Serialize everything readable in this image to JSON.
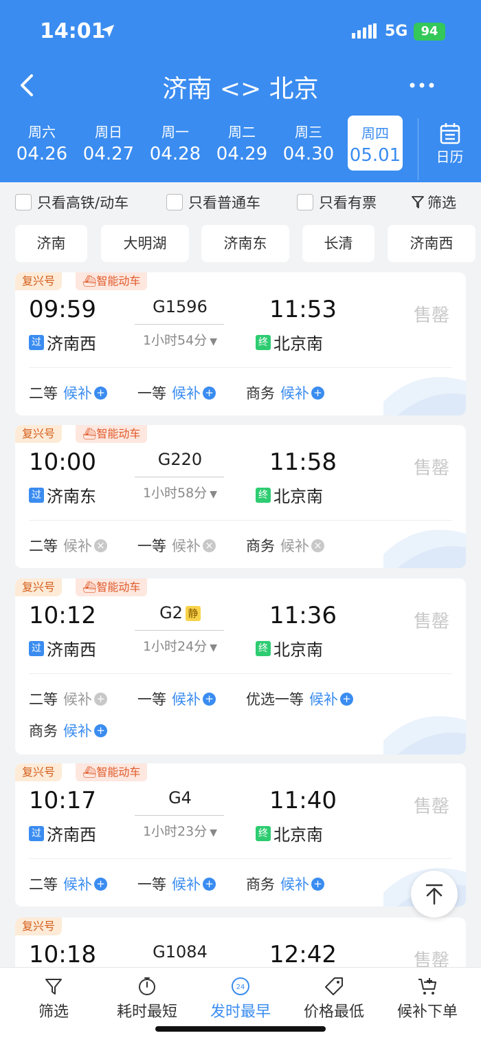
{
  "status_bar": {
    "time": "14:01",
    "network": "5G",
    "battery": "94"
  },
  "header": {
    "title": "济南 <> 北京"
  },
  "dates": [
    {
      "weekday": "周六",
      "date": "04.26",
      "selected": false
    },
    {
      "weekday": "周日",
      "date": "04.27",
      "selected": false
    },
    {
      "weekday": "周一",
      "date": "04.28",
      "selected": false
    },
    {
      "weekday": "周二",
      "date": "04.29",
      "selected": false
    },
    {
      "weekday": "周三",
      "date": "04.30",
      "selected": false
    },
    {
      "weekday": "周四",
      "date": "05.01",
      "selected": true
    }
  ],
  "calendar_label": "日历",
  "filters": {
    "high_speed": "只看高铁/动车",
    "normal": "只看普通车",
    "available": "只看有票",
    "filter": "筛选"
  },
  "stations": [
    "济南",
    "大明湖",
    "济南东",
    "长清",
    "济南西"
  ],
  "trains": [
    {
      "tag1": "复兴号",
      "tag2": "智能动车",
      "depart": "09:59",
      "number": "G1596",
      "quiet": "",
      "duration": "1小时54分",
      "arrive": "11:53",
      "from_badge": "过",
      "from": "济南西",
      "to_badge": "终",
      "to": "北京南",
      "status": "售罄",
      "seats": [
        {
          "name": "二等",
          "label": "候补",
          "active": true
        },
        {
          "name": "一等",
          "label": "候补",
          "active": true
        },
        {
          "name": "商务",
          "label": "候补",
          "active": true
        }
      ]
    },
    {
      "tag1": "复兴号",
      "tag2": "智能动车",
      "depart": "10:00",
      "number": "G220",
      "quiet": "",
      "duration": "1小时58分",
      "arrive": "11:58",
      "from_badge": "过",
      "from": "济南东",
      "to_badge": "终",
      "to": "北京南",
      "status": "售罄",
      "seats": [
        {
          "name": "二等",
          "label": "候补",
          "active": false
        },
        {
          "name": "一等",
          "label": "候补",
          "active": false
        },
        {
          "name": "商务",
          "label": "候补",
          "active": false
        }
      ]
    },
    {
      "tag1": "复兴号",
      "tag2": "智能动车",
      "depart": "10:12",
      "number": "G2",
      "quiet": "静",
      "duration": "1小时24分",
      "arrive": "11:36",
      "from_badge": "过",
      "from": "济南西",
      "to_badge": "终",
      "to": "北京南",
      "status": "售罄",
      "seats": [
        {
          "name": "二等",
          "label": "候补",
          "active": false
        },
        {
          "name": "一等",
          "label": "候补",
          "active": true
        },
        {
          "name": "优选一等",
          "label": "候补",
          "active": true
        },
        {
          "name": "商务",
          "label": "候补",
          "active": true
        }
      ]
    },
    {
      "tag1": "复兴号",
      "tag2": "智能动车",
      "depart": "10:17",
      "number": "G4",
      "quiet": "",
      "duration": "1小时23分",
      "arrive": "11:40",
      "from_badge": "过",
      "from": "济南西",
      "to_badge": "终",
      "to": "北京南",
      "status": "售罄",
      "seats": [
        {
          "name": "二等",
          "label": "候补",
          "active": true
        },
        {
          "name": "一等",
          "label": "候补",
          "active": true
        },
        {
          "name": "商务",
          "label": "候补",
          "active": true
        }
      ]
    },
    {
      "tag1": "复兴号",
      "tag2": "",
      "depart": "10:18",
      "number": "G1084",
      "quiet": "",
      "duration": "",
      "arrive": "12:42",
      "from_badge": "",
      "from": "",
      "to_badge": "",
      "to": "",
      "status": "售罄",
      "seats": []
    }
  ],
  "bottom_tabs": [
    {
      "label": "筛选",
      "icon": "funnel-icon",
      "active": false
    },
    {
      "label": "耗时最短",
      "icon": "timer-icon",
      "active": false
    },
    {
      "label": "发时最早",
      "icon": "clock-24-icon",
      "icon_text": "24",
      "active": true
    },
    {
      "label": "价格最低",
      "icon": "price-tag-icon",
      "active": false
    },
    {
      "label": "候补下单",
      "icon": "cart-plus-icon",
      "active": false
    }
  ],
  "colors": {
    "primary": "#3a8cf0",
    "tag_orange": "#d45d1a",
    "soldout": "#c8c8c8",
    "end_badge": "#2ecc71",
    "battery": "#34c759"
  }
}
